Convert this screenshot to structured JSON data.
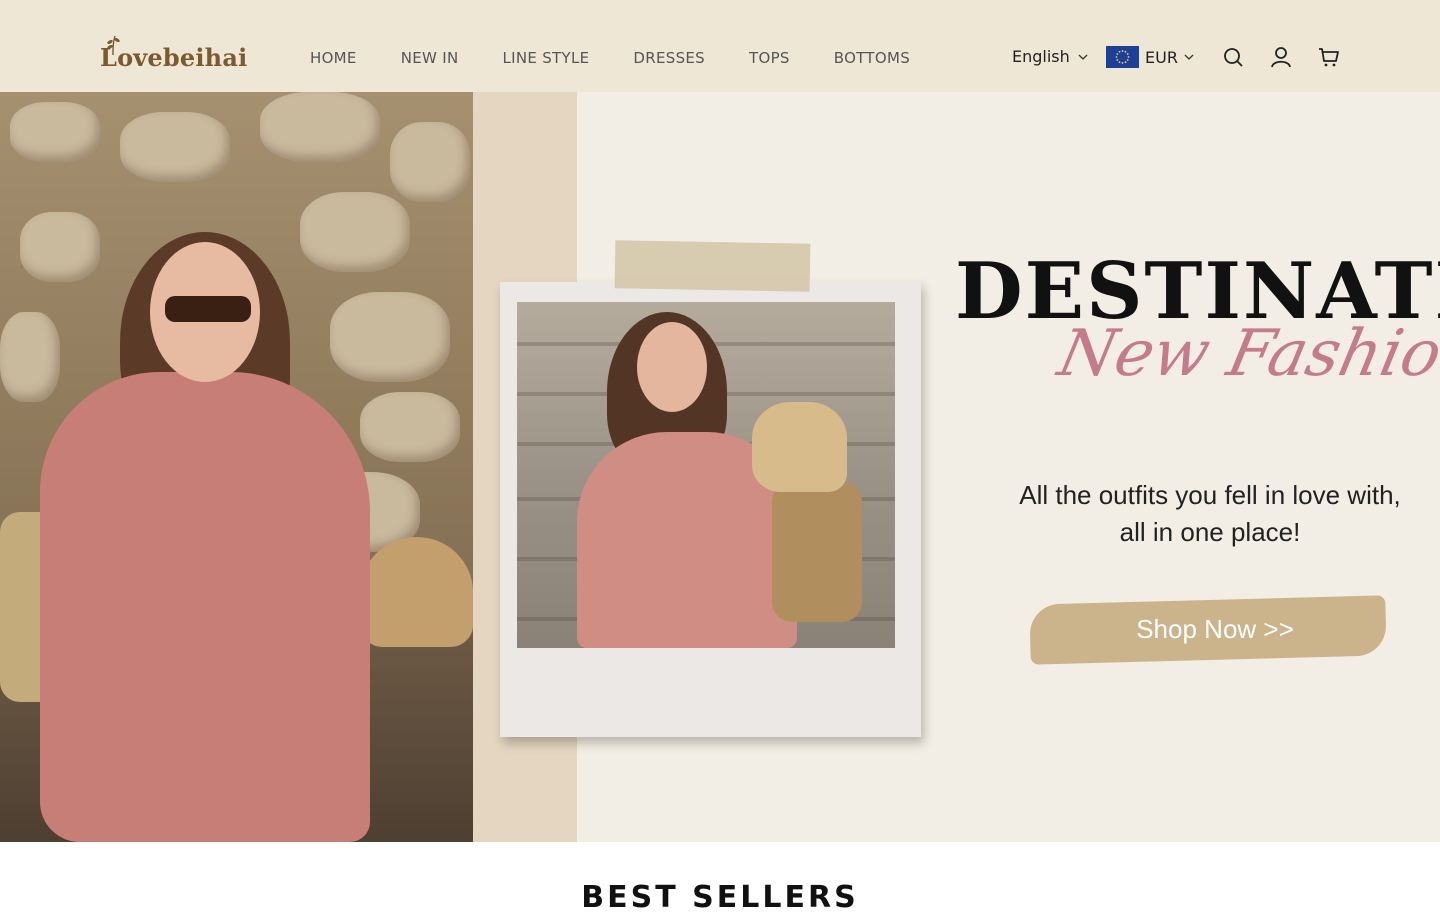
{
  "header": {
    "logo_text": "Lovebeihai",
    "nav": [
      "HOME",
      "NEW IN",
      "LINE STYLE",
      "DRESSES",
      "TOPS",
      "BOTTOMS"
    ],
    "language": "English",
    "currency": "EUR"
  },
  "hero": {
    "title": "DESTINATIO",
    "script": "New Fashion",
    "subtitle_line1": "All the outfits you fell in love with,",
    "subtitle_line2": "all in one place!",
    "cta": "Shop Now >>"
  },
  "section": {
    "title": "BEST SELLERS"
  },
  "colors": {
    "header_bg": "#efe7d6",
    "logo": "#7a5a2e",
    "nav_text": "#555555",
    "script_pink": "#c47c8a",
    "cta_brush": "#cbb48c"
  },
  "icons": [
    "sprig-icon",
    "chevron-down-icon",
    "eu-flag-icon",
    "search-icon",
    "user-icon",
    "cart-icon"
  ]
}
